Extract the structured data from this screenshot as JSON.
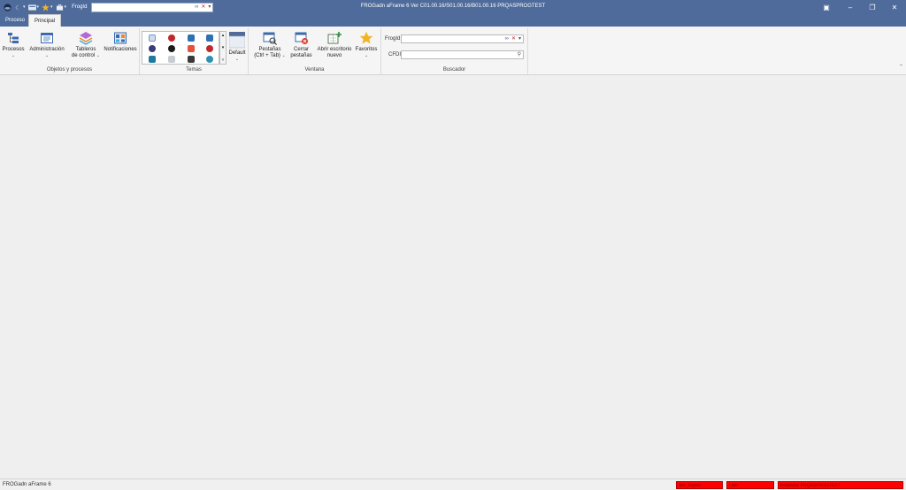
{
  "window": {
    "title": "FROGadn aFrame 6 Ver C01.00.16/S01.00.16/B01.00.16 PRQASPROGTEST",
    "controls": [
      "restore-window",
      "minimize",
      "maximize",
      "close"
    ]
  },
  "qat": {
    "frogid_label": "FrogId",
    "frogid_value": "",
    "icons": [
      "app-logo-icon",
      "undo-icon",
      "layout-icon",
      "star-icon",
      "briefcase-icon"
    ]
  },
  "tabs": [
    {
      "label": "Proceso",
      "active": false
    },
    {
      "label": "Principal",
      "active": true
    }
  ],
  "ribbon": {
    "groups": {
      "objetos": {
        "label": "Objetos y procesos",
        "buttons": {
          "procesos": "Procesos",
          "administracion": "Administración",
          "tableros_l1": "Tableros",
          "tableros_l2": "de control",
          "notificaciones": "Notificaciones"
        }
      },
      "temas": {
        "label": "Temas",
        "default_label": "Default",
        "swatch_colors": [
          "#3a3a7a",
          "#c0282c",
          "#2f6fb5",
          "#2f6fb5",
          "#3a3a7a",
          "#c0282c",
          "#2f6fb5",
          "#2f6fb5",
          "#1a1a1a",
          "#a0a0a0",
          "#1a1a1a",
          "#2f8fb5"
        ]
      },
      "ventana": {
        "label": "Ventana",
        "buttons": {
          "pestanas_l1": "Pestañas",
          "pestanas_l2": "(Ctrl + Tab)",
          "cerrar_l1": "Cerrar",
          "cerrar_l2": "pestañas",
          "abrir_l1": "Abrir escritorio",
          "abrir_l2": "nuevo",
          "favoritos": "Favoritos"
        }
      },
      "buscador": {
        "label": "Buscador",
        "frogid_label": "FrogId",
        "frogid_value": "",
        "cfdi_label": "CFDI",
        "cfdi_value": ""
      }
    }
  },
  "status": {
    "app_name": "FROGadn aFrame 6",
    "panels": [
      "Ser_Espeo",
      "Lote",
      "Instancia: PRQASPROGTEST"
    ]
  },
  "colors": {
    "title_bar": "#4e6b9b",
    "status_panel": "#ff0000"
  }
}
